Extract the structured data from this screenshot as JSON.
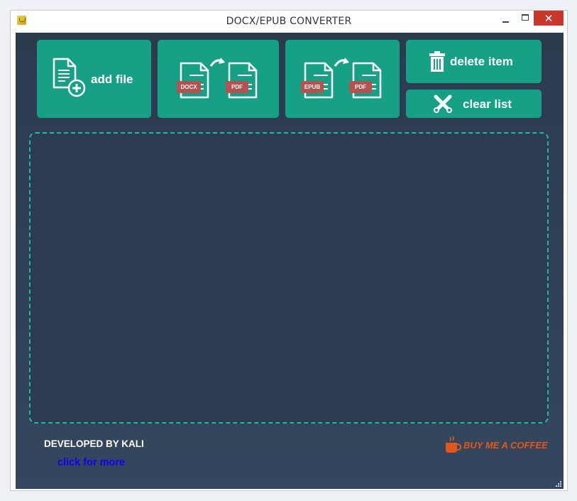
{
  "window": {
    "title": "DOCX/EPUB CONVERTER",
    "close_glyph": "✕"
  },
  "toolbar": {
    "add_file_label": "add file",
    "docx_to_pdf": {
      "from_badge": "DOCX",
      "to_badge": "PDF"
    },
    "epub_to_pdf": {
      "from_badge": "EPUB",
      "to_badge": "PDF"
    },
    "delete_item_label": "delete item",
    "clear_list_label": "clear list"
  },
  "footer": {
    "developer_text": "DEVELOPED BY KALI",
    "more_link_text": "click for more",
    "coffee_text": "BUY ME A COFFEE"
  },
  "colors": {
    "accent": "#16a085",
    "dashed_border": "#1abc9c",
    "background": "#2f3e53",
    "badge": "#b5514f",
    "link": "#0a00ff",
    "coffee": "#e2571e"
  },
  "icons": {
    "add_file": "file-plus-icon",
    "convert": "convert-arrow-icon",
    "delete": "trash-icon",
    "clear": "clear-x-icon"
  }
}
